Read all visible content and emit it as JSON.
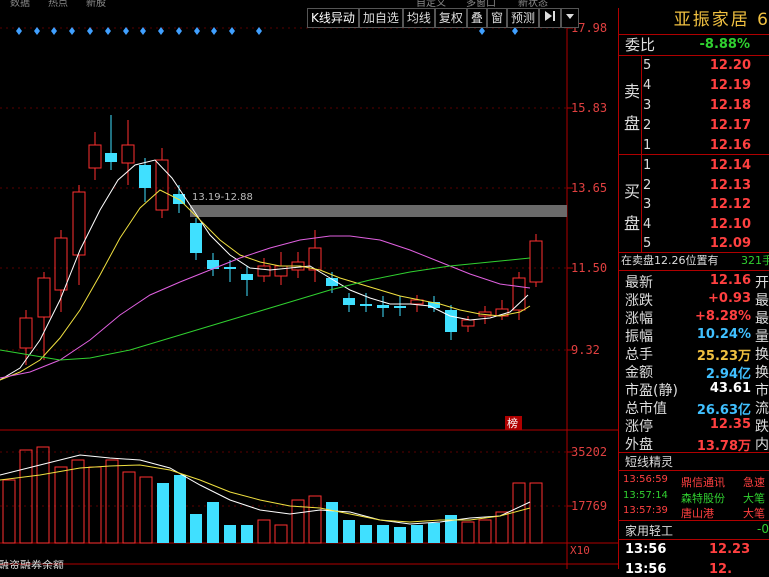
{
  "top_strip": {
    "items": [
      "数据",
      "热点",
      "新股",
      "自定义",
      "多窗口",
      "新状态"
    ]
  },
  "toolbar": {
    "buttons": [
      "K线异动",
      "加自选",
      "均线",
      "复权",
      "叠",
      "窗",
      "预测"
    ],
    "right_icon": "play-end-icon",
    "dropdown_icon": "triangle-down-icon"
  },
  "chart": {
    "price_axis": [
      "17.98",
      "15.83",
      "13.65",
      "11.50",
      "9.32"
    ],
    "range_label": "13.19-12.88",
    "rank_badge": "榜",
    "volume_axis": [
      "35202",
      "17769"
    ],
    "volume_unit": "X10",
    "bottom_tab": "融资融券余额",
    "colors": {
      "up": "#ff3030",
      "down": "#40e0ff",
      "ma5": "#ffffff",
      "ma10": "#f0e040",
      "ma20": "#e060e0",
      "ma60": "#30d030",
      "grid": "#b00000"
    }
  },
  "panel": {
    "title": "亚振家居 6",
    "wei_label": "委比",
    "wei_value": "-8.88%",
    "sell_label": [
      "卖",
      "盘"
    ],
    "buy_label": [
      "买",
      "盘"
    ],
    "sell": [
      {
        "level": "5",
        "price": "12.20"
      },
      {
        "level": "4",
        "price": "12.19"
      },
      {
        "level": "3",
        "price": "12.18"
      },
      {
        "level": "2",
        "price": "12.17"
      },
      {
        "level": "1",
        "price": "12.16"
      }
    ],
    "buy": [
      {
        "level": "1",
        "price": "12.14"
      },
      {
        "level": "2",
        "price": "12.13"
      },
      {
        "level": "3",
        "price": "12.12"
      },
      {
        "level": "4",
        "price": "12.10"
      },
      {
        "level": "5",
        "price": "12.09"
      }
    ],
    "notice": "在卖盘12.26位置有",
    "notice_qty": "321手",
    "quotes": [
      {
        "label": "最新",
        "value": "12.16",
        "tail": "开",
        "color": "red"
      },
      {
        "label": "涨跌",
        "value": "+0.93",
        "tail": "最",
        "color": "red"
      },
      {
        "label": "涨幅",
        "value": "+8.28%",
        "tail": "最",
        "color": "red"
      },
      {
        "label": "振幅",
        "value": "10.24%",
        "tail": "量",
        "color": "cyan"
      },
      {
        "label": "总手",
        "value": "25.23万",
        "tail": "换",
        "color": "yellow"
      },
      {
        "label": "金额",
        "value": "2.94亿",
        "tail": "换",
        "color": "cyan"
      },
      {
        "label": "市盈(静)",
        "value": "43.61",
        "tail": "市",
        "color": "white"
      },
      {
        "label": "总市值",
        "value": "26.63亿",
        "tail": "流",
        "color": "cyan"
      },
      {
        "label": "涨停",
        "value": "12.35",
        "tail": "跌",
        "color": "red"
      },
      {
        "label": "外盘",
        "value": "13.78万",
        "tail": "内",
        "color": "red"
      }
    ],
    "sprite": {
      "title": "短线精灵",
      "rows": [
        {
          "time": "13:56:59",
          "name": "鼎信通讯",
          "event": "急速",
          "color": "red"
        },
        {
          "time": "13:57:14",
          "name": "森特股份",
          "event": "大笔",
          "color": "green"
        },
        {
          "time": "13:57:39",
          "name": "唐山港",
          "event": "大笔",
          "color": "red"
        }
      ]
    },
    "sector": {
      "name": "家用轻工",
      "change": "-0."
    },
    "ticks": [
      {
        "time": "13:56",
        "price": "12.23"
      },
      {
        "time": "13:56",
        "price": "12."
      }
    ]
  }
}
